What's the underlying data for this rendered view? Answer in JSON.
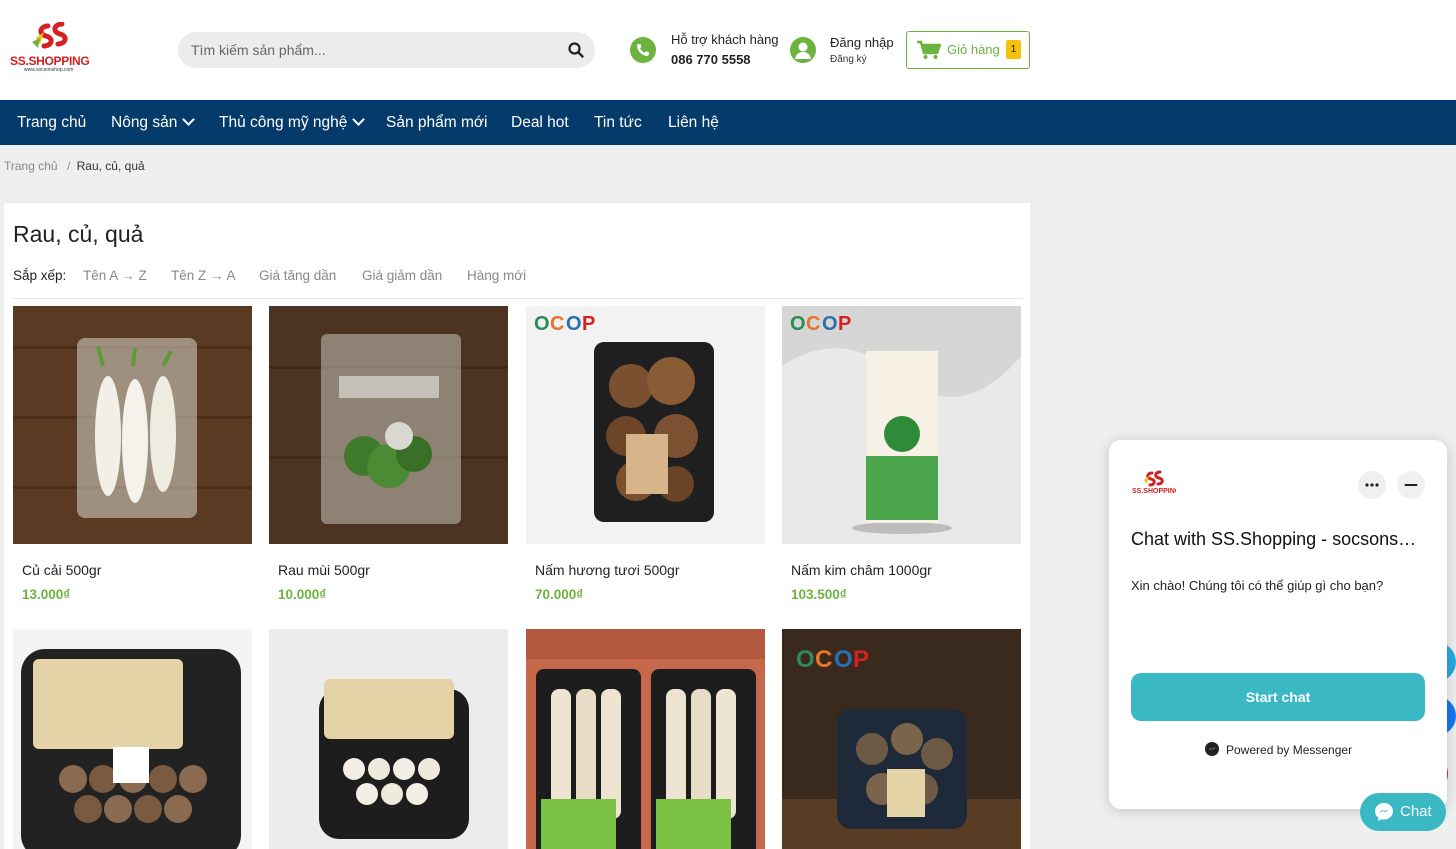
{
  "header": {
    "logo_text": "SS.SHOPPING",
    "logo_sub": "www.socsonshop.com",
    "search_placeholder": "Tìm kiếm sản phẩm...",
    "support_label": "Hỗ trợ khách hàng",
    "support_phone": "086 770 5558",
    "login_label": "Đăng nhập",
    "register_label": "Đăng ký",
    "cart_label": "Giỏ hàng",
    "cart_count": "1"
  },
  "nav": {
    "items": [
      {
        "label": "Trang chủ"
      },
      {
        "label": "Nông sản"
      },
      {
        "label": "Thủ công mỹ nghệ"
      },
      {
        "label": "Sản phẩm mới"
      },
      {
        "label": "Deal hot"
      },
      {
        "label": "Tin tức"
      },
      {
        "label": "Liên hệ"
      }
    ]
  },
  "breadcrumb": {
    "home": "Trang chủ",
    "separator": "/",
    "current": "Rau, củ, quả"
  },
  "category": {
    "title": "Rau, củ, quả",
    "sort_label": "Sắp xếp:",
    "sort_options": [
      "Tên A → Z",
      "Tên Z → A",
      "Giá tăng dần",
      "Giá giảm dần",
      "Hàng mới"
    ]
  },
  "products": [
    {
      "name": "Củ cải 500gr",
      "price": "13.000₫"
    },
    {
      "name": "Rau mùi 500gr",
      "price": "10.000₫"
    },
    {
      "name": "Nấm hương tươi 500gr",
      "price": "70.000₫"
    },
    {
      "name": "Nấm kim châm 1000gr",
      "price": "103.500₫"
    },
    {
      "name": "",
      "price": ""
    },
    {
      "name": "",
      "price": ""
    },
    {
      "name": "",
      "price": ""
    },
    {
      "name": "",
      "price": ""
    }
  ],
  "chat_widget": {
    "title": "Chat with SS.Shopping - socsonshop.com",
    "greeting": "Xin chào! Chúng tôi có thể giúp gì cho bạn?",
    "start_label": "Start chat",
    "powered_by": "Powered by Messenger",
    "bubble_label": "Chat"
  },
  "colors": {
    "brand_green": "#6cb33f",
    "nav_blue": "#053b6a",
    "chat_teal": "#3ab8c4",
    "badge_yellow": "#f4c20d"
  }
}
